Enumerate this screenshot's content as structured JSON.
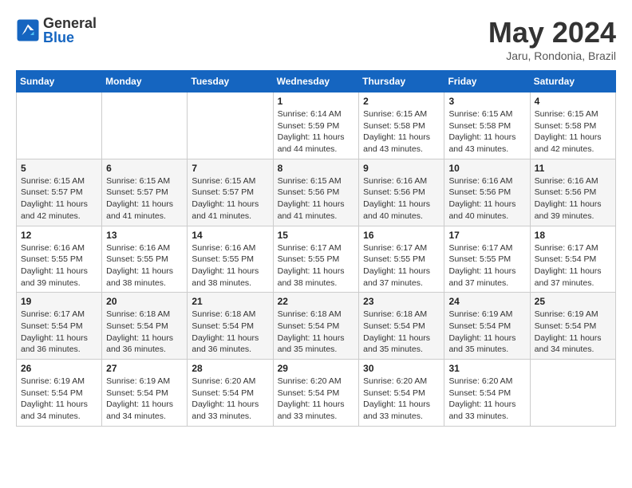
{
  "logo": {
    "general": "General",
    "blue": "Blue"
  },
  "title": "May 2024",
  "location": "Jaru, Rondonia, Brazil",
  "headers": [
    "Sunday",
    "Monday",
    "Tuesday",
    "Wednesday",
    "Thursday",
    "Friday",
    "Saturday"
  ],
  "weeks": [
    [
      {
        "day": "",
        "info": ""
      },
      {
        "day": "",
        "info": ""
      },
      {
        "day": "",
        "info": ""
      },
      {
        "day": "1",
        "info": "Sunrise: 6:14 AM\nSunset: 5:59 PM\nDaylight: 11 hours\nand 44 minutes."
      },
      {
        "day": "2",
        "info": "Sunrise: 6:15 AM\nSunset: 5:58 PM\nDaylight: 11 hours\nand 43 minutes."
      },
      {
        "day": "3",
        "info": "Sunrise: 6:15 AM\nSunset: 5:58 PM\nDaylight: 11 hours\nand 43 minutes."
      },
      {
        "day": "4",
        "info": "Sunrise: 6:15 AM\nSunset: 5:58 PM\nDaylight: 11 hours\nand 42 minutes."
      }
    ],
    [
      {
        "day": "5",
        "info": "Sunrise: 6:15 AM\nSunset: 5:57 PM\nDaylight: 11 hours\nand 42 minutes."
      },
      {
        "day": "6",
        "info": "Sunrise: 6:15 AM\nSunset: 5:57 PM\nDaylight: 11 hours\nand 41 minutes."
      },
      {
        "day": "7",
        "info": "Sunrise: 6:15 AM\nSunset: 5:57 PM\nDaylight: 11 hours\nand 41 minutes."
      },
      {
        "day": "8",
        "info": "Sunrise: 6:15 AM\nSunset: 5:56 PM\nDaylight: 11 hours\nand 41 minutes."
      },
      {
        "day": "9",
        "info": "Sunrise: 6:16 AM\nSunset: 5:56 PM\nDaylight: 11 hours\nand 40 minutes."
      },
      {
        "day": "10",
        "info": "Sunrise: 6:16 AM\nSunset: 5:56 PM\nDaylight: 11 hours\nand 40 minutes."
      },
      {
        "day": "11",
        "info": "Sunrise: 6:16 AM\nSunset: 5:56 PM\nDaylight: 11 hours\nand 39 minutes."
      }
    ],
    [
      {
        "day": "12",
        "info": "Sunrise: 6:16 AM\nSunset: 5:55 PM\nDaylight: 11 hours\nand 39 minutes."
      },
      {
        "day": "13",
        "info": "Sunrise: 6:16 AM\nSunset: 5:55 PM\nDaylight: 11 hours\nand 38 minutes."
      },
      {
        "day": "14",
        "info": "Sunrise: 6:16 AM\nSunset: 5:55 PM\nDaylight: 11 hours\nand 38 minutes."
      },
      {
        "day": "15",
        "info": "Sunrise: 6:17 AM\nSunset: 5:55 PM\nDaylight: 11 hours\nand 38 minutes."
      },
      {
        "day": "16",
        "info": "Sunrise: 6:17 AM\nSunset: 5:55 PM\nDaylight: 11 hours\nand 37 minutes."
      },
      {
        "day": "17",
        "info": "Sunrise: 6:17 AM\nSunset: 5:55 PM\nDaylight: 11 hours\nand 37 minutes."
      },
      {
        "day": "18",
        "info": "Sunrise: 6:17 AM\nSunset: 5:54 PM\nDaylight: 11 hours\nand 37 minutes."
      }
    ],
    [
      {
        "day": "19",
        "info": "Sunrise: 6:17 AM\nSunset: 5:54 PM\nDaylight: 11 hours\nand 36 minutes."
      },
      {
        "day": "20",
        "info": "Sunrise: 6:18 AM\nSunset: 5:54 PM\nDaylight: 11 hours\nand 36 minutes."
      },
      {
        "day": "21",
        "info": "Sunrise: 6:18 AM\nSunset: 5:54 PM\nDaylight: 11 hours\nand 36 minutes."
      },
      {
        "day": "22",
        "info": "Sunrise: 6:18 AM\nSunset: 5:54 PM\nDaylight: 11 hours\nand 35 minutes."
      },
      {
        "day": "23",
        "info": "Sunrise: 6:18 AM\nSunset: 5:54 PM\nDaylight: 11 hours\nand 35 minutes."
      },
      {
        "day": "24",
        "info": "Sunrise: 6:19 AM\nSunset: 5:54 PM\nDaylight: 11 hours\nand 35 minutes."
      },
      {
        "day": "25",
        "info": "Sunrise: 6:19 AM\nSunset: 5:54 PM\nDaylight: 11 hours\nand 34 minutes."
      }
    ],
    [
      {
        "day": "26",
        "info": "Sunrise: 6:19 AM\nSunset: 5:54 PM\nDaylight: 11 hours\nand 34 minutes."
      },
      {
        "day": "27",
        "info": "Sunrise: 6:19 AM\nSunset: 5:54 PM\nDaylight: 11 hours\nand 34 minutes."
      },
      {
        "day": "28",
        "info": "Sunrise: 6:20 AM\nSunset: 5:54 PM\nDaylight: 11 hours\nand 33 minutes."
      },
      {
        "day": "29",
        "info": "Sunrise: 6:20 AM\nSunset: 5:54 PM\nDaylight: 11 hours\nand 33 minutes."
      },
      {
        "day": "30",
        "info": "Sunrise: 6:20 AM\nSunset: 5:54 PM\nDaylight: 11 hours\nand 33 minutes."
      },
      {
        "day": "31",
        "info": "Sunrise: 6:20 AM\nSunset: 5:54 PM\nDaylight: 11 hours\nand 33 minutes."
      },
      {
        "day": "",
        "info": ""
      }
    ]
  ]
}
